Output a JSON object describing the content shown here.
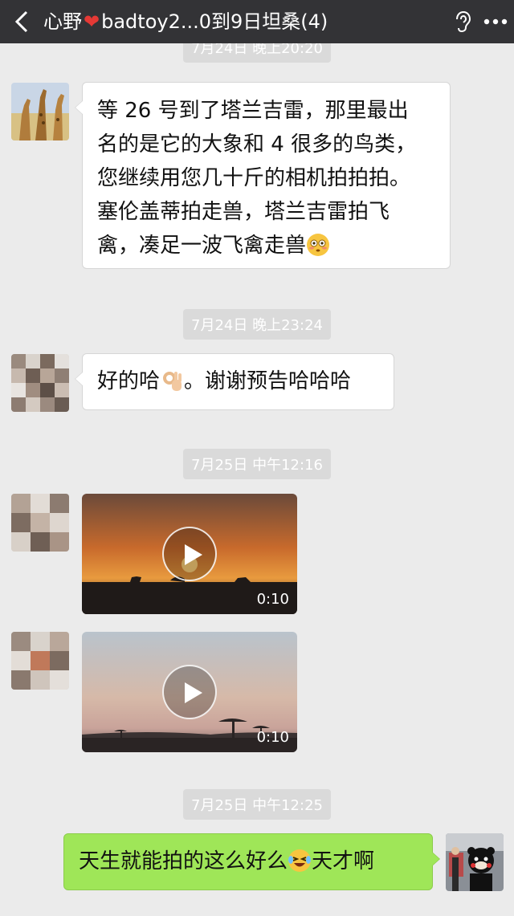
{
  "header": {
    "title_prefix": "心野",
    "title_suffix": "badtoy2...0到9日坦桑(4)"
  },
  "colors": {
    "header_bg": "#333336",
    "chat_bg": "#ebebeb",
    "outgoing_bubble": "#9fe658",
    "incoming_bubble": "#ffffff",
    "timestamp_bg": "#dadada"
  },
  "icons": {
    "back": "chevron-left-icon",
    "ear": "ear-icon",
    "more": "more-dots-icon",
    "play": "play-icon"
  },
  "messages": {
    "top_timestamp": "7月24日 晚上20:20",
    "msg1_lines": [
      "等 26 号到了塔兰吉雷，那里最出",
      "名的是它的大象和 4 很多的鸟类，",
      "您继续用您几十斤的相机拍拍拍。",
      "塞伦盖蒂拍走兽，塔兰吉雷拍飞",
      "禽，凑足一波飞禽走兽"
    ],
    "ts2": "7月24日 晚上23:24",
    "msg2_before": "好的哈",
    "msg2_after": "。谢谢预告哈哈哈",
    "ts3": "7月25日 中午12:16",
    "video1_duration": "0:10",
    "video2_duration": "0:10",
    "ts4": "7月25日 中午12:25",
    "msg3_before": "天生就能拍的这么好么",
    "msg3_after": "天才啊"
  }
}
